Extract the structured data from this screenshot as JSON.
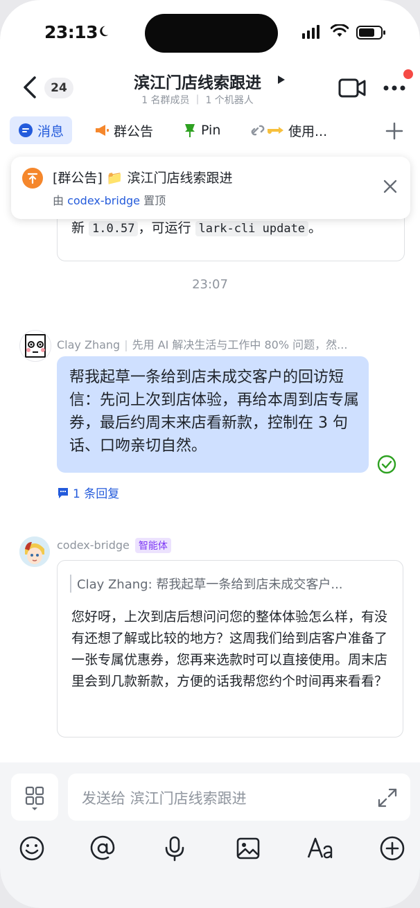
{
  "status_bar": {
    "time": "23:13"
  },
  "header": {
    "back_count": "24",
    "title": "滨江门店线索跟进",
    "subtitle": "1 名群成员 ｜ 1 个机器人"
  },
  "tabs": [
    {
      "label": "消息",
      "icon": "message-icon"
    },
    {
      "label": "群公告",
      "icon": "megaphone-icon"
    },
    {
      "label": "Pin",
      "icon": "pin-icon"
    },
    {
      "label": "使用...",
      "icon": "link-icon"
    }
  ],
  "pinned_announcement": {
    "title": "[群公告] 📁 滨江门店线索跟进",
    "by_prefix": "由 ",
    "by": "codex-bridge",
    "by_suffix": " 置顶"
  },
  "previous_message": {
    "text_prefix": "新 ",
    "version": "1.0.57",
    "text_mid": "，可运行 ",
    "command": "lark-cli update",
    "text_suffix": "。"
  },
  "timestamp": "23:07",
  "messages": [
    {
      "sender": "Clay Zhang",
      "signature": "先用 AI 解决生活与工作中 80% 问题，然...",
      "text": "帮我起草一条给到店未成交客户的回访短信：先问上次到店体验，再给本周到店专属券，最后约周末来店看新款，控制在 3 句话、口吻亲切自然。",
      "replies": "1 条回复"
    },
    {
      "sender": "codex-bridge",
      "badge": "智能体",
      "quote": "Clay Zhang: 帮我起草一条给到店未成交客户...",
      "text": "您好呀，上次到店后想问问您的整体体验怎么样，有没有还想了解或比较的地方？这周我们给到店客户准备了一张专属优惠券，您再来选款时可以直接使用。周末店里会到几款新款，方便的话我帮您约个时间再来看看？"
    }
  ],
  "composer": {
    "placeholder": "发送给 滨江门店线索跟进"
  },
  "toolbar": [
    "emoji-icon",
    "mention-icon",
    "microphone-icon",
    "image-icon",
    "font-icon",
    "plus-icon"
  ],
  "colors": {
    "accent": "#245bdb",
    "bubble": "#cfe0ff",
    "badge": "#7f3bf5"
  }
}
